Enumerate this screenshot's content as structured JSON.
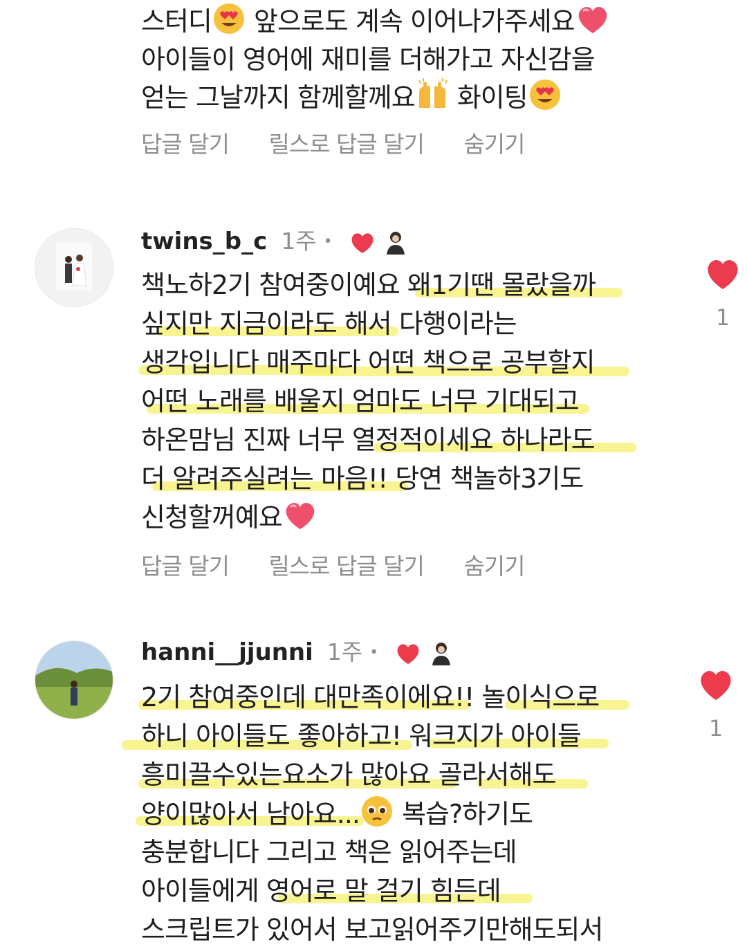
{
  "colors": {
    "heart_red": "#ed3b4e",
    "muted": "#8e8e8e",
    "highlight": "#f6f06e"
  },
  "top_comment": {
    "lines": [
      "스터디",
      "앞으로도 계속 이어나가주세요",
      "아이들이 영어에 재미를 더해가고 자신감을",
      "얻는 그날까지 함께할께요",
      "화이팅"
    ],
    "actions": {
      "reply": "답글 달기",
      "reply_reels": "릴스로 답글 달기",
      "hide": "숨기기"
    }
  },
  "comments": [
    {
      "username": "twins_b_c",
      "time": "1주",
      "dot": "•",
      "lines": [
        "책노하2기 참여중이예요 왜1기땐 몰랐을까",
        "싶지만 지금이라도 해서 다행이라는",
        "생각입니다 매주마다 어떤 책으로 공부할지",
        "어떤 노래를 배울지 엄마도 너무 기대되고",
        "하온맘님 진짜 너무 열정적이세요 하나라도",
        "더 알려주실려는 마음!! 당연 책놀하3기도",
        "신청할꺼예요"
      ],
      "like_count": "1",
      "actions": {
        "reply": "답글 달기",
        "reply_reels": "릴스로 답글 달기",
        "hide": "숨기기"
      }
    },
    {
      "username": "hanni__jjunni",
      "time": "1주",
      "dot": "•",
      "lines": [
        "2기 참여중인데 대만족이에요!! 놀이식으로",
        "하니 아이들도 좋아하고! 워크지가 아이들",
        "흥미끌수있는요소가 많아요 골라서해도",
        "양이많아서 남아요...",
        "복습?하기도",
        "충분합니다 그리고 책은 읽어주는데",
        "아이들에게 영어로 말 걸기 힘든데",
        "스크립트가 있어서 보고읽어주기만해도되서"
      ],
      "like_count": "1"
    }
  ],
  "icons": {
    "heart_eyes": "heart-eyes-emoji",
    "red_heart": "red-heart-emoji",
    "raised_hands": "raised-hands-emoji",
    "pleading_face": "pleading-face-emoji",
    "like": "heart-icon",
    "creator_liked": "creator-liked-heart-icon"
  }
}
